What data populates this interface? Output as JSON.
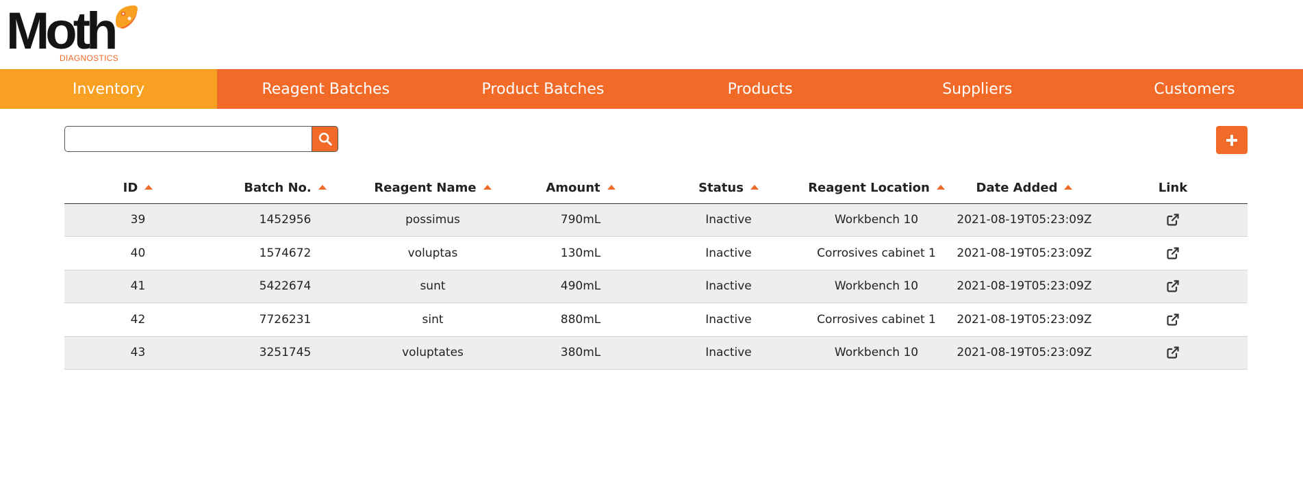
{
  "brand": {
    "name": "Moth",
    "tagline": "DIAGNOSTICS",
    "colors": {
      "primary": "#f26a28",
      "active": "#f8a022",
      "dark": "#141414"
    }
  },
  "nav": {
    "items": [
      {
        "label": "Inventory",
        "active": true
      },
      {
        "label": "Reagent Batches",
        "active": false
      },
      {
        "label": "Product Batches",
        "active": false
      },
      {
        "label": "Products",
        "active": false
      },
      {
        "label": "Suppliers",
        "active": false
      },
      {
        "label": "Customers",
        "active": false
      }
    ]
  },
  "toolbar": {
    "search_value": "",
    "search_placeholder": "",
    "search_icon": "search-icon",
    "add_icon": "plus-icon"
  },
  "table": {
    "columns": [
      {
        "label": "ID",
        "sortable": true
      },
      {
        "label": "Batch No.",
        "sortable": true
      },
      {
        "label": "Reagent Name",
        "sortable": true
      },
      {
        "label": "Amount",
        "sortable": true
      },
      {
        "label": "Status",
        "sortable": true
      },
      {
        "label": "Reagent Location",
        "sortable": true
      },
      {
        "label": "Date Added",
        "sortable": true
      },
      {
        "label": "Link",
        "sortable": false
      }
    ],
    "rows": [
      [
        "39",
        "1452956",
        "possimus",
        "790mL",
        "Inactive",
        "Workbench 10",
        "2021-08-19T05:23:09Z"
      ],
      [
        "40",
        "1574672",
        "voluptas",
        "130mL",
        "Inactive",
        "Corrosives cabinet 1",
        "2021-08-19T05:23:09Z"
      ],
      [
        "41",
        "5422674",
        "sunt",
        "490mL",
        "Inactive",
        "Workbench 10",
        "2021-08-19T05:23:09Z"
      ],
      [
        "42",
        "7726231",
        "sint",
        "880mL",
        "Inactive",
        "Corrosives cabinet 1",
        "2021-08-19T05:23:09Z"
      ],
      [
        "43",
        "3251745",
        "voluptates",
        "380mL",
        "Inactive",
        "Workbench 10",
        "2021-08-19T05:23:09Z"
      ]
    ],
    "link_icon": "external-link-icon"
  }
}
